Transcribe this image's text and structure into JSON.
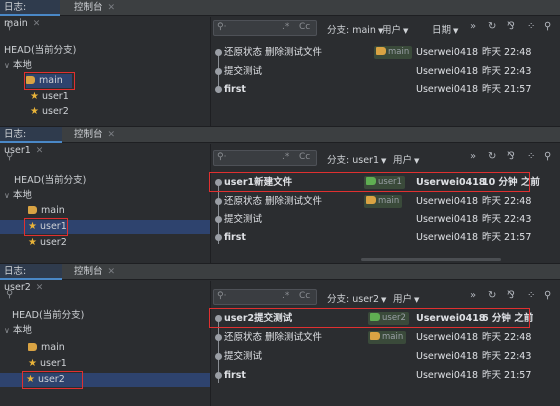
{
  "panels": [
    {
      "tabs": [
        {
          "label": "日志: main",
          "closable": true
        },
        {
          "label": "控制台",
          "closable": true
        }
      ],
      "tree": [
        {
          "label": "HEAD(当前分支)",
          "kind": "head"
        },
        {
          "label": "本地",
          "kind": "group"
        },
        {
          "label": "main",
          "kind": "tag",
          "selected": true
        },
        {
          "label": "user1",
          "kind": "star"
        },
        {
          "label": "user2",
          "kind": "star"
        }
      ],
      "toolbar": {
        "filter_cc": "Cc",
        "branch_label": "分支: main",
        "user_label": "用户",
        "date_label": "日期",
        "more": "»"
      },
      "commits": [
        {
          "message": "还原状态 删除测试文件",
          "tag": "main",
          "author": "Userwei0418",
          "date": "昨天 22:48",
          "bold": false
        },
        {
          "message": "提交测试",
          "tag": "",
          "author": "Userwei0418",
          "date": "昨天 22:43",
          "bold": false
        },
        {
          "message": "first",
          "tag": "",
          "author": "Userwei0418",
          "date": "昨天 21:57",
          "bold": false
        }
      ]
    },
    {
      "tabs": [
        {
          "label": "日志: user1",
          "closable": true
        },
        {
          "label": "控制台",
          "closable": true
        }
      ],
      "tree": [
        {
          "label": "HEAD(当前分支)",
          "kind": "head"
        },
        {
          "label": "本地",
          "kind": "group"
        },
        {
          "label": "main",
          "kind": "tag"
        },
        {
          "label": "user1",
          "kind": "star",
          "selected": true
        },
        {
          "label": "user2",
          "kind": "star"
        }
      ],
      "toolbar": {
        "filter_cc": "Cc",
        "branch_label": "分支: user1",
        "user_label": "用户",
        "date_label": "",
        "more": "»"
      },
      "commits": [
        {
          "message": "user1新建文件",
          "tag": "user1",
          "author": "Userwei0418",
          "date": "10 分钟 之前",
          "bold": true
        },
        {
          "message": "还原状态 删除测试文件",
          "tag": "main",
          "author": "Userwei0418",
          "date": "昨天 22:48",
          "bold": false
        },
        {
          "message": "提交测试",
          "tag": "",
          "author": "Userwei0418",
          "date": "昨天 22:43",
          "bold": false
        },
        {
          "message": "first",
          "tag": "",
          "author": "Userwei0418",
          "date": "昨天 21:57",
          "bold": false
        }
      ]
    },
    {
      "tabs": [
        {
          "label": "日志: user2",
          "closable": true
        },
        {
          "label": "控制台",
          "closable": true
        }
      ],
      "tree": [
        {
          "label": "HEAD(当前分支)",
          "kind": "head"
        },
        {
          "label": "本地",
          "kind": "group"
        },
        {
          "label": "main",
          "kind": "tag"
        },
        {
          "label": "user1",
          "kind": "star"
        },
        {
          "label": "user2",
          "kind": "star",
          "selected": true
        }
      ],
      "toolbar": {
        "filter_cc": "Cc",
        "branch_label": "分支: user2",
        "user_label": "用户",
        "date_label": "",
        "more": "»"
      },
      "commits": [
        {
          "message": "user2提交测试",
          "tag": "user2",
          "author": "Userwei0418",
          "date": "6 分钟 之前",
          "bold": true
        },
        {
          "message": "还原状态 删除测试文件",
          "tag": "main",
          "author": "Userwei0418",
          "date": "昨天 22:48",
          "bold": false
        },
        {
          "message": "提交测试",
          "tag": "",
          "author": "Userwei0418",
          "date": "昨天 22:43",
          "bold": false
        },
        {
          "message": "first",
          "tag": "",
          "author": "Userwei0418",
          "date": "昨天 21:57",
          "bold": false
        }
      ]
    }
  ],
  "colors": {
    "tag_main": "#d9a343",
    "tag_branch": "#5fae52",
    "highlight": "#e03030",
    "selection": "#2e436e"
  },
  "icons": {
    "search": "search-icon",
    "regex": "regex-icon",
    "refresh": "refresh-icon",
    "cherry_pick": "cherry-pick-icon",
    "grid": "grid-icon",
    "settings": "settings-icon",
    "tag": "tag-icon",
    "star": "star-icon",
    "close": "close-icon"
  }
}
